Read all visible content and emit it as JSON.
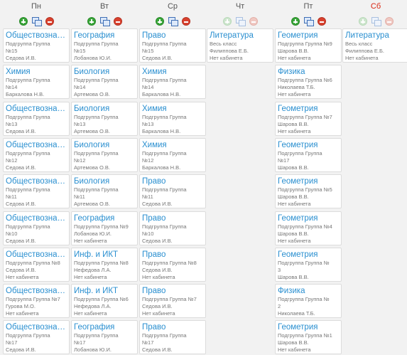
{
  "days": [
    {
      "label": "Пн",
      "weekend": false,
      "tools_enabled": true,
      "lessons": [
        {
          "subject": "Обществознание",
          "lines": [
            "Подгруппа Группа",
            "№15",
            "Седова И.В."
          ]
        },
        {
          "subject": "Химия",
          "lines": [
            "Подгруппа Группа",
            "№14",
            "Баркалова Н.В.",
            "Нет кабинета"
          ]
        },
        {
          "subject": "Обществознание",
          "lines": [
            "Подгруппа Группа",
            "№13",
            "Седова И.В."
          ]
        },
        {
          "subject": "Обществознание",
          "lines": [
            "Подгруппа Группа",
            "№12",
            "Седова И.В."
          ]
        },
        {
          "subject": "Обществознание",
          "lines": [
            "Подгруппа Группа",
            "№11",
            "Седова И.В."
          ]
        },
        {
          "subject": "Обществознание",
          "lines": [
            "Подгруппа Группа",
            "№10",
            "Седова И.В."
          ]
        },
        {
          "subject": "Обществознание",
          "lines": [
            "Подгруппа Группа №8",
            "Седова И.В.",
            "Нет кабинета"
          ]
        },
        {
          "subject": "Обществознание",
          "lines": [
            "Подгруппа Группа №7",
            "Гурова М.О.",
            "Нет кабинета"
          ]
        },
        {
          "subject": "Обществознание",
          "lines": [
            "Подгруппа Группа",
            "№17",
            "Седова И.В."
          ]
        }
      ]
    },
    {
      "label": "Вт",
      "weekend": false,
      "tools_enabled": true,
      "lessons": [
        {
          "subject": "География",
          "lines": [
            "Подгруппа Группа",
            "№15",
            "Лобанова Ю.И."
          ]
        },
        {
          "subject": "Биология",
          "lines": [
            "Подгруппа Группа",
            "№14",
            "Артемова О.В."
          ]
        },
        {
          "subject": "Биология",
          "lines": [
            "Подгруппа Группа",
            "№13",
            "Артемова О.В."
          ]
        },
        {
          "subject": "Биология",
          "lines": [
            "Подгруппа Группа",
            "№12",
            "Артемова О.В.",
            "Нет кабинета"
          ]
        },
        {
          "subject": "Биология",
          "lines": [
            "Подгруппа Группа",
            "№11",
            "Артемова О.В."
          ]
        },
        {
          "subject": "География",
          "lines": [
            "Подгруппа Группа №9",
            "Лобанова Ю.И.",
            "Нет кабинета"
          ]
        },
        {
          "subject": "Инф. и ИКТ",
          "lines": [
            "Подгруппа Группа №8",
            "Нефедова Л.А.",
            "Нет кабинета"
          ]
        },
        {
          "subject": "Инф. и ИКТ",
          "lines": [
            "Подгруппа Группа №6",
            "Нефедова Л.А.",
            "Нет кабинета"
          ]
        },
        {
          "subject": "География",
          "lines": [
            "Подгруппа Группа",
            "№17",
            "Лобанова Ю.И."
          ]
        }
      ]
    },
    {
      "label": "Ср",
      "weekend": false,
      "tools_enabled": true,
      "lessons": [
        {
          "subject": "Право",
          "lines": [
            "Подгруппа Группа",
            "№15",
            "Седова И.В."
          ]
        },
        {
          "subject": "Химия",
          "lines": [
            "Подгруппа Группа",
            "№14",
            "Баркалова Н.В."
          ]
        },
        {
          "subject": "Химия",
          "lines": [
            "Подгруппа Группа",
            "№13",
            "Баркалова Н.В."
          ]
        },
        {
          "subject": "Химия",
          "lines": [
            "Подгруппа Группа",
            "№12",
            "Баркалова Н.В."
          ]
        },
        {
          "subject": "Право",
          "lines": [
            "Подгруппа Группа",
            "№11",
            "Седова И.В."
          ]
        },
        {
          "subject": "Право",
          "lines": [
            "Подгруппа Группа",
            "№10",
            "Седова И.В."
          ]
        },
        {
          "subject": "Право",
          "lines": [
            "Подгруппа Группа №8",
            "Седова И.В.",
            "Нет кабинета"
          ]
        },
        {
          "subject": "Право",
          "lines": [
            "Подгруппа Группа №7",
            "Седова И.В.",
            "Нет кабинета"
          ]
        },
        {
          "subject": "Право",
          "lines": [
            "Подгруппа Группа",
            "№17",
            "Седова И.В."
          ]
        }
      ]
    },
    {
      "label": "Чт",
      "weekend": false,
      "tools_enabled": false,
      "lessons": [
        {
          "subject": "Литература",
          "lines": [
            "Весь класс",
            "Филиппова Е.Б.",
            "Нет кабинета"
          ]
        }
      ]
    },
    {
      "label": "Пт",
      "weekend": false,
      "tools_enabled": true,
      "lessons": [
        {
          "subject": "Геометрия",
          "lines": [
            "Подгруппа Группа №9",
            "Шарова В.В.",
            "Нет кабинета"
          ]
        },
        {
          "subject": "Физика",
          "lines": [
            "Подгруппа Группа №6",
            "Николаева Т.Б.",
            "Нет кабинета"
          ]
        },
        {
          "subject": "Геометрия",
          "lines": [
            "Подгруппа Группа №7",
            "Шарова В.В.",
            "Нет кабинета"
          ]
        },
        {
          "subject": "Геометрия",
          "lines": [
            "Подгруппа Группа",
            "№17",
            "Шарова В.В."
          ]
        },
        {
          "subject": "Геометрия",
          "lines": [
            "Подгруппа Группа №5",
            "Шарова В.В.",
            "Нет кабинета"
          ]
        },
        {
          "subject": "Геометрия",
          "lines": [
            "Подгруппа Группа №4",
            "Шарова В.В.",
            "Нет кабинета"
          ]
        },
        {
          "subject": "Геометрия",
          "lines": [
            "Подгруппа Группа №",
            "3",
            "Шарова В.В.",
            "Нет кабинета"
          ]
        },
        {
          "subject": "Физика",
          "lines": [
            "Подгруппа Группа №",
            "2",
            "Николаева Т.Б.",
            "Нет кабинета"
          ]
        },
        {
          "subject": "Геометрия",
          "lines": [
            "Подгруппа Группа №1",
            "Шарова В.В.",
            "Нет кабинета"
          ]
        }
      ]
    },
    {
      "label": "Сб",
      "weekend": true,
      "tools_enabled": false,
      "lessons": [
        {
          "subject": "Литература",
          "lines": [
            "Весь класс",
            "Филиппова Е.Б.",
            "Нет кабинета"
          ]
        }
      ]
    }
  ],
  "colors": {
    "subject": "#2a8fd0",
    "weekend_label": "#d9230f",
    "add": "#3aa63a",
    "remove": "#d9412e"
  },
  "icons": {
    "add": "plus-circle-icon",
    "copy": "copy-icon",
    "remove": "minus-circle-icon"
  }
}
